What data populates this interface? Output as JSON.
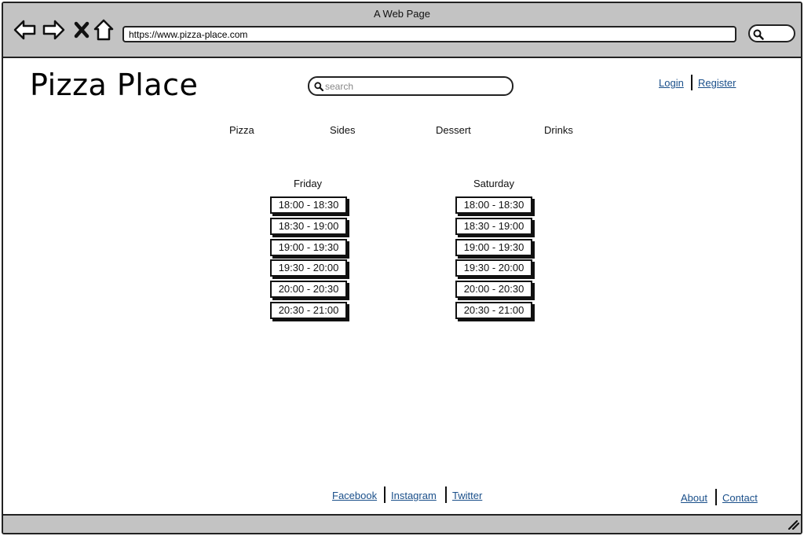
{
  "browser": {
    "window_title": "A Web Page",
    "url": "https://www.pizza-place.com",
    "icons": [
      "back-arrow-icon",
      "forward-arrow-icon",
      "close-icon",
      "home-icon",
      "search-icon",
      "resize-grip-icon"
    ]
  },
  "header": {
    "logo": "Pizza Place",
    "search_placeholder": "search",
    "login": "Login",
    "register": "Register"
  },
  "menu": {
    "items": [
      "Pizza",
      "Sides",
      "Dessert",
      "Drinks"
    ]
  },
  "schedule": {
    "days": [
      {
        "name": "Friday",
        "slots": [
          "18:00 - 18:30",
          "18:30 - 19:00",
          "19:00 - 19:30",
          "19:30 - 20:00",
          "20:00 - 20:30",
          "20:30 - 21:00"
        ]
      },
      {
        "name": "Saturday",
        "slots": [
          "18:00 - 18:30",
          "18:30 - 19:00",
          "19:00 - 19:30",
          "19:30 - 20:00",
          "20:00 - 20:30",
          "20:30 - 21:00"
        ]
      }
    ]
  },
  "footer": {
    "social": [
      "Facebook",
      "Instagram",
      "Twitter"
    ],
    "about": "About",
    "contact": "Contact"
  },
  "colors": {
    "chrome": "#c3c3c3",
    "link": "#1a4f8a",
    "ink": "#111111"
  }
}
